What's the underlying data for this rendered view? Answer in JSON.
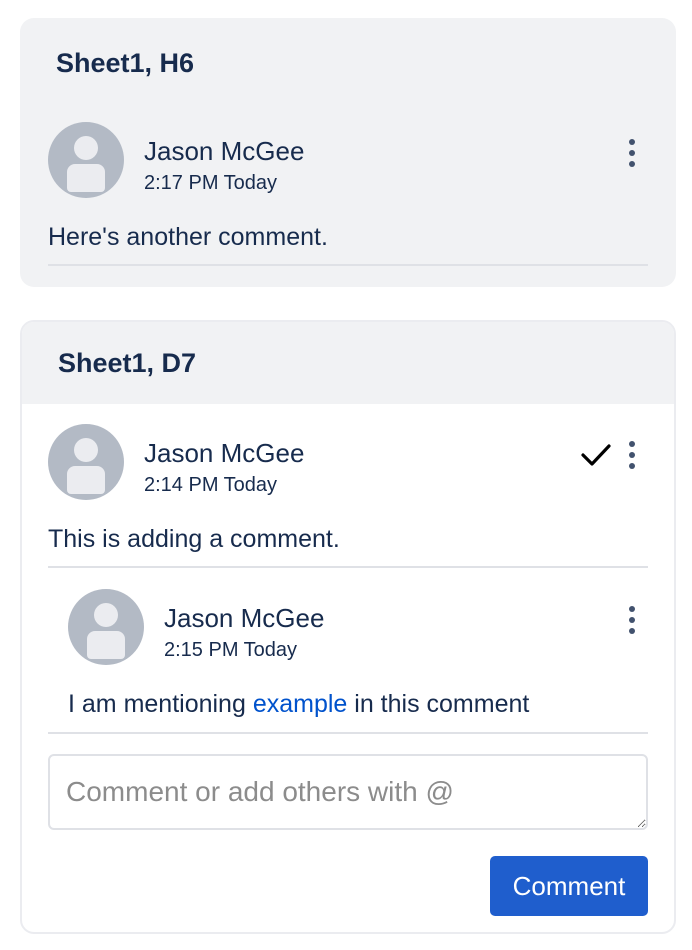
{
  "threads": [
    {
      "title": "Sheet1, H6",
      "comments": [
        {
          "author": "Jason McGee",
          "time": "2:17 PM Today",
          "text": "Here's another comment."
        }
      ]
    },
    {
      "title": "Sheet1, D7",
      "resolved_icon": "checkmark-icon",
      "comments": [
        {
          "author": "Jason McGee",
          "time": "2:14 PM Today",
          "text": "This is adding a comment."
        }
      ],
      "replies": [
        {
          "author": "Jason McGee",
          "time": "2:15 PM Today",
          "text_before": "I am mentioning ",
          "mention": "example",
          "text_after": " in this comment"
        }
      ],
      "composer": {
        "placeholder": "Comment or add others with @",
        "value": "",
        "submit_label": "Comment"
      }
    }
  ],
  "colors": {
    "accent": "#1f5ecd",
    "mention": "#0052cc",
    "header_bg": "#f1f2f4",
    "avatar": "#b3bac5"
  }
}
